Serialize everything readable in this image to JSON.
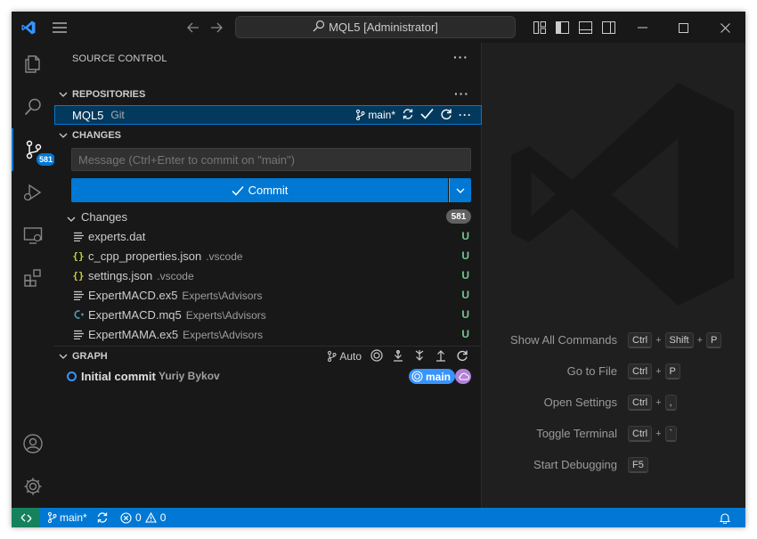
{
  "titlebar": {
    "title": "MQL5 [Administrator]"
  },
  "activity_bar": {
    "items": [
      {
        "name": "explorer"
      },
      {
        "name": "search"
      },
      {
        "name": "source-control",
        "badge": "581"
      },
      {
        "name": "run-debug"
      },
      {
        "name": "remote-explorer"
      },
      {
        "name": "extensions"
      }
    ]
  },
  "sidebar": {
    "title": "SOURCE CONTROL",
    "repositories_header": "REPOSITORIES",
    "repo": {
      "name": "MQL5",
      "kind": "Git",
      "branch": "main*"
    },
    "changes_header": "CHANGES",
    "message_placeholder": "Message (Ctrl+Enter to commit on \"main\")",
    "commit_label": "Commit",
    "changes_group": {
      "label": "Changes",
      "count": "581"
    },
    "files": [
      {
        "name": "experts.dat",
        "dir": "",
        "status": "U",
        "icon": "lines-icon",
        "icon_color": "#cccccc"
      },
      {
        "name": "c_cpp_properties.json",
        "dir": ".vscode",
        "status": "U",
        "icon": "json-braces-icon",
        "icon_color": "#cbcb41"
      },
      {
        "name": "settings.json",
        "dir": ".vscode",
        "status": "U",
        "icon": "json-braces-icon",
        "icon_color": "#cbcb41"
      },
      {
        "name": "ExpertMACD.ex5",
        "dir": "Experts\\Advisors",
        "status": "U",
        "icon": "lines-icon",
        "icon_color": "#cccccc"
      },
      {
        "name": "ExpertMACD.mq5",
        "dir": "Experts\\Advisors",
        "status": "U",
        "icon": "c-plus-icon",
        "icon_color": "#519aba"
      },
      {
        "name": "ExpertMAMA.ex5",
        "dir": "Experts\\Advisors",
        "status": "U",
        "icon": "lines-icon",
        "icon_color": "#cccccc"
      }
    ],
    "graph_header": "GRAPH",
    "graph_auto": "Auto",
    "commit": {
      "message": "Initial commit",
      "author": "Yuriy Bykov",
      "branch": "main"
    }
  },
  "editor": {
    "shortcuts": [
      {
        "label": "Show All Commands",
        "keys": [
          "Ctrl",
          "+",
          "Shift",
          "+",
          "P"
        ]
      },
      {
        "label": "Go to File",
        "keys": [
          "Ctrl",
          "+",
          "P"
        ]
      },
      {
        "label": "Open Settings",
        "keys": [
          "Ctrl",
          "+",
          ","
        ]
      },
      {
        "label": "Toggle Terminal",
        "keys": [
          "Ctrl",
          "+",
          "`"
        ]
      },
      {
        "label": "Start Debugging",
        "keys": [
          "F5"
        ]
      }
    ]
  },
  "statusbar": {
    "branch": "main*",
    "errors": "0",
    "warnings": "0"
  },
  "colors": {
    "accent": "#0078d4",
    "remote_indicator": "#16825d",
    "untracked": "#73c991"
  }
}
